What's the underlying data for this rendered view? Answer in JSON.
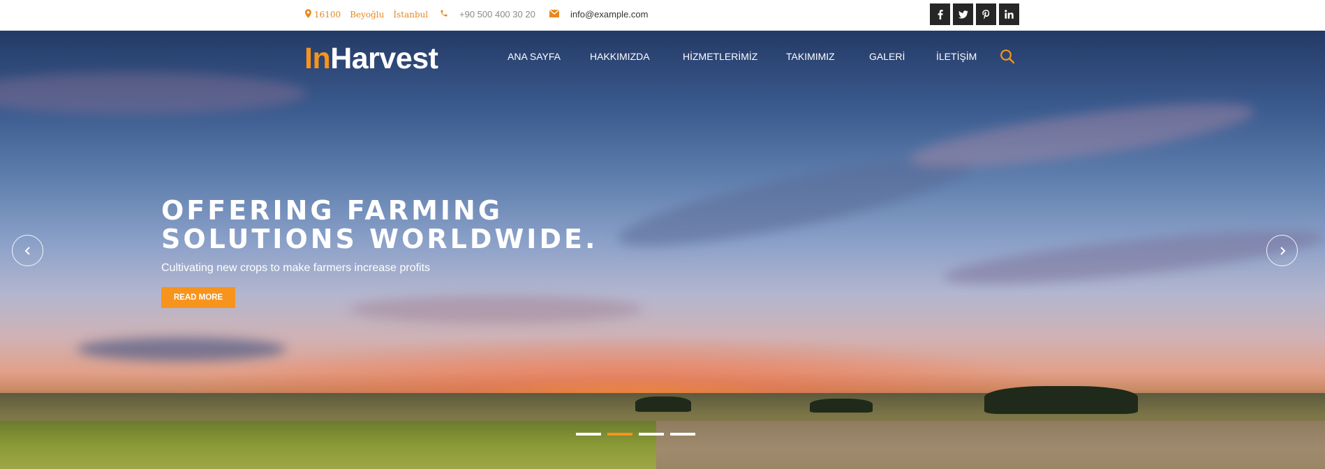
{
  "topbar": {
    "address_parts": [
      "16100",
      "Beyoğlu",
      "İstanbul"
    ],
    "phone": "+90 500 400 30 20",
    "email": "info@example.com",
    "social": [
      {
        "name": "facebook-icon",
        "glyph": "f"
      },
      {
        "name": "twitter-icon",
        "glyph": "t"
      },
      {
        "name": "pinterest-icon",
        "glyph": "p"
      },
      {
        "name": "linkedin-icon",
        "glyph": "in"
      }
    ]
  },
  "logo": {
    "accent": "In",
    "rest": "Harvest"
  },
  "nav": {
    "items": [
      "ANA SAYFA",
      "HAKKIMIZDA",
      "HİZMETLERİMİZ",
      "TAKIMIMIZ",
      "GALERİ",
      "İLETİŞİM"
    ]
  },
  "hero": {
    "title_line1": "OFFERING FARMING",
    "title_line2": "SOLUTIONS WORLDWIDE.",
    "subtitle": "Cultivating new crops to make farmers increase profits",
    "button": "READ MORE",
    "slide_count": 4,
    "active_slide": 2
  },
  "colors": {
    "accent": "#f7941d",
    "social_bg": "#262626"
  }
}
